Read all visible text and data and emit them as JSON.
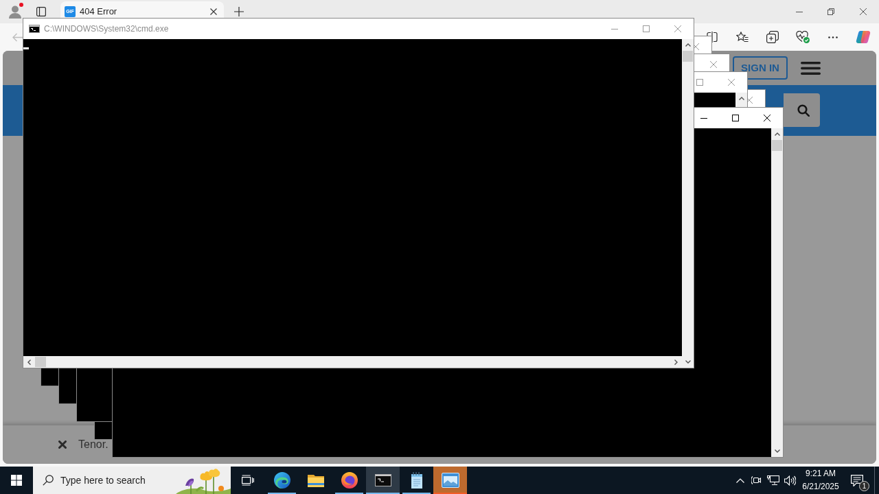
{
  "browser": {
    "tabs": [
      {
        "label": "404 Error",
        "favicon_text": "GIF",
        "selected": true
      }
    ],
    "toolbar": {
      "back": {
        "disabled": true
      }
    },
    "page": {
      "header": {
        "sign_in": "SIGN IN"
      },
      "bottom_bar": {
        "text": "Tenor."
      }
    }
  },
  "console_windows": [
    {
      "title": "C:\\WINDOWS\\System32\\cmd.exe",
      "active": false,
      "cursor": true,
      "horizontal_scrollbar": true
    },
    {
      "active": false
    },
    {
      "active": false
    },
    {
      "active": false
    },
    {
      "active": false
    },
    {
      "active": true
    }
  ],
  "taskbar": {
    "search": {
      "placeholder": "Type here to search"
    },
    "apps": [
      {
        "kind": "swirl",
        "running": true,
        "selected": false,
        "flashing": false
      },
      {
        "kind": "folder",
        "running": false,
        "selected": false,
        "flashing": false
      },
      {
        "kind": "fox",
        "running": true,
        "selected": false,
        "flashing": false
      },
      {
        "kind": "terminal",
        "running": true,
        "selected": true,
        "flashing": false
      },
      {
        "kind": "notepad",
        "running": true,
        "selected": false,
        "flashing": false
      },
      {
        "kind": "window",
        "running": true,
        "selected": false,
        "flashing": true
      }
    ],
    "clock": {
      "time": "9:21 AM",
      "date": "6/21/2025"
    },
    "notifications": {
      "count": "1"
    }
  }
}
